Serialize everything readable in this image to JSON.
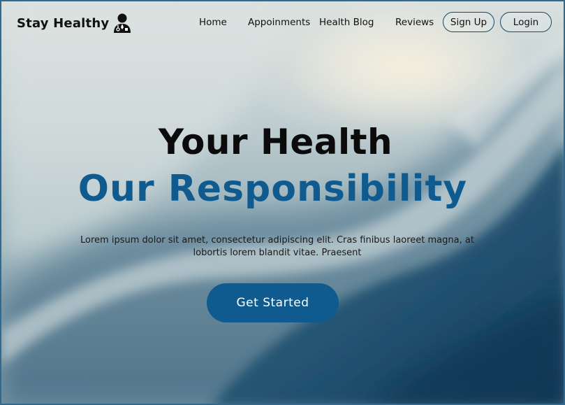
{
  "brand": {
    "name": "Stay Healthy",
    "icon": "doctor-icon"
  },
  "nav": {
    "links": [
      "Home",
      "Appoinments",
      "Health Blog",
      "Reviews"
    ],
    "signup_label": "Sign Up",
    "login_label": "Login"
  },
  "hero": {
    "title_line1": "Your Health",
    "title_line2": "Our Responsibility",
    "description": "Lorem ipsum dolor sit amet, consectetur adipiscing elit. Cras finibus laoreet magna, at lobortis lorem blandit vitae. Praesent",
    "cta_label": "Get Started"
  },
  "colors": {
    "accent": "#0f5b8f",
    "text": "#111111",
    "button_border": "#1b4a68"
  }
}
